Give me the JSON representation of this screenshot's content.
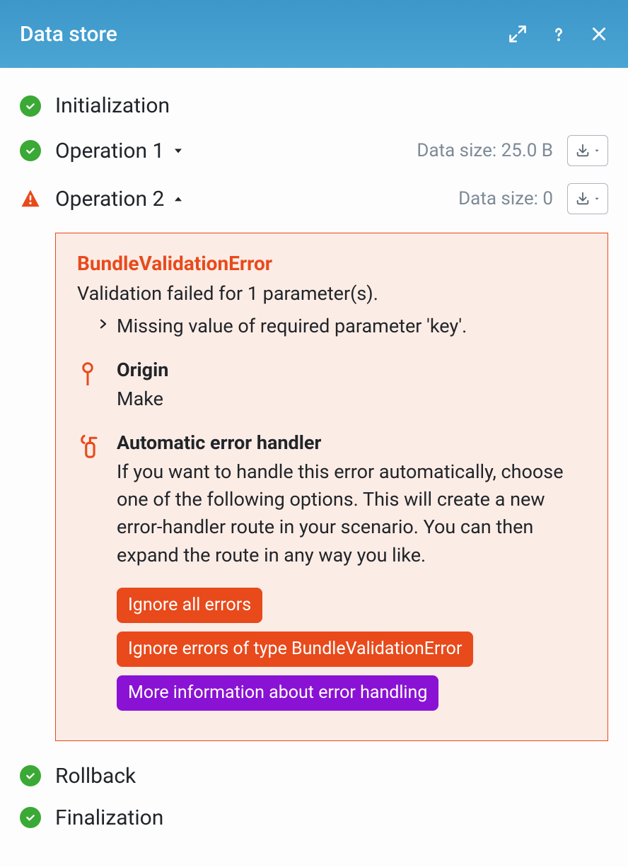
{
  "header": {
    "title": "Data store"
  },
  "steps": {
    "initialization": {
      "label": "Initialization"
    },
    "operation1": {
      "label": "Operation 1",
      "data_size": "Data size: 25.0 B"
    },
    "operation2": {
      "label": "Operation 2",
      "data_size": "Data size: 0"
    },
    "rollback": {
      "label": "Rollback"
    },
    "finalization": {
      "label": "Finalization"
    }
  },
  "error": {
    "title": "BundleValidationError",
    "message": "Validation failed for 1 parameter(s).",
    "detail": "Missing value of required parameter 'key'.",
    "origin": {
      "heading": "Origin",
      "value": "Make"
    },
    "handler": {
      "heading": "Automatic error handler",
      "text": "If you want to handle this error automatically, choose one of the following options. This will create a new error-handler route in your scenario. You can then expand the route in any way you like."
    },
    "buttons": {
      "ignore_all": "Ignore all errors",
      "ignore_type": "Ignore errors of type BundleValidationError",
      "more_info": "More information about error handling"
    }
  }
}
